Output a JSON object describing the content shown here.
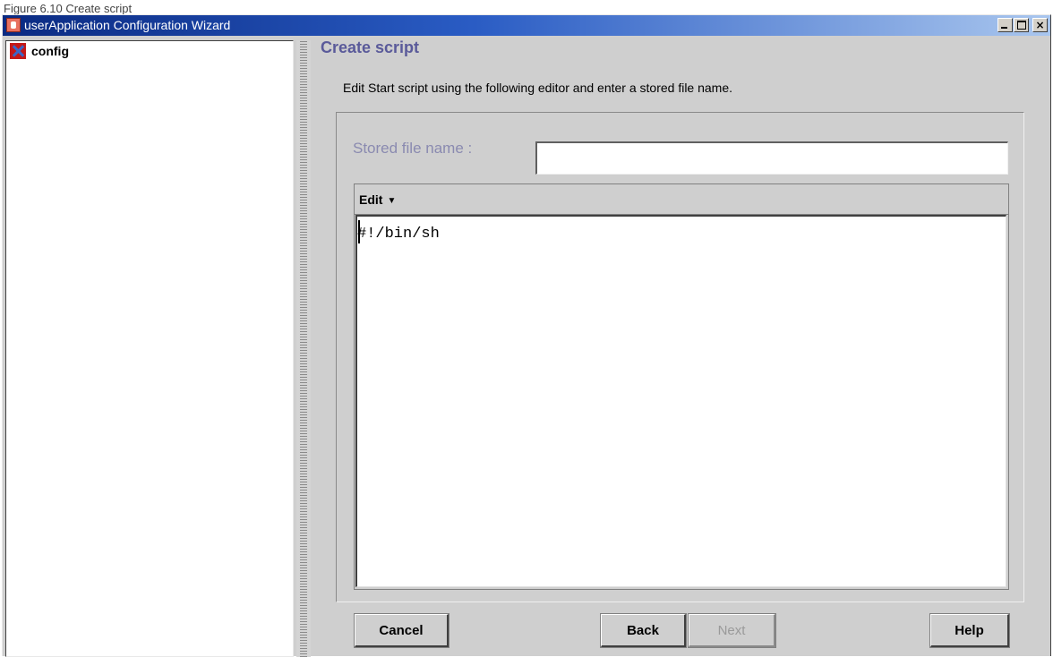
{
  "caption": "Figure 6.10 Create script",
  "window": {
    "title": "userApplication Configuration Wizard",
    "controls": {
      "minimize": "_",
      "maximize": "□",
      "close": "×"
    }
  },
  "tree": {
    "root_label": "config",
    "root_icon": "config-icon"
  },
  "main": {
    "heading": "Create script",
    "instruction": "Edit Start script using the following editor and enter a stored file name.",
    "stored_file_label": "Stored file name  :",
    "stored_file_value": "",
    "editor": {
      "menu_label": "Edit",
      "menu_arrow": "▼",
      "content": "#!/bin/sh"
    }
  },
  "buttons": {
    "cancel": "Cancel",
    "back": "Back",
    "next": "Next",
    "help": "Help"
  },
  "colors": {
    "titlebar_start": "#0a2a82",
    "titlebar_end": "#a9c6ee",
    "heading": "#5a5a9a",
    "window_bg": "#cfcfcf"
  }
}
